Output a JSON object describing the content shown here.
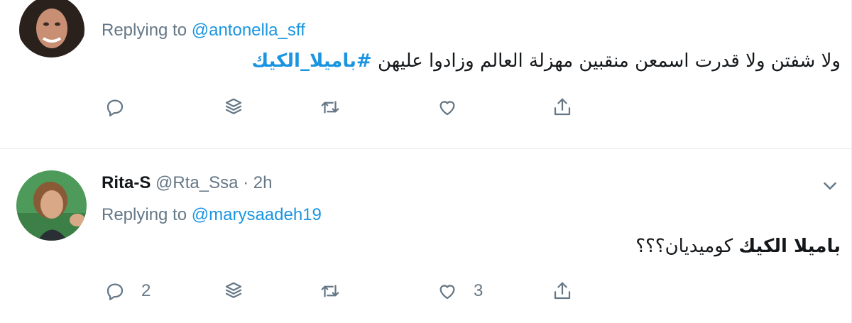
{
  "tweets": [
    {
      "display_name": "",
      "handle": "",
      "time": "",
      "replying_label": "Replying to",
      "replying_to": "@antonella_sff",
      "text_main": "ولا شفتن ولا قدرت اسمعن منقبين مهزلة العالم وزادوا عليهن",
      "hashtag": "#باميلا_الكيك",
      "actions": {
        "reply_count": "",
        "like_count": ""
      }
    },
    {
      "display_name": "Rita-S",
      "handle": "@Rta_Ssa",
      "time": "2h",
      "replying_label": "Replying to",
      "replying_to": "@marysaadeh19",
      "text_bold": "باميلا الكيك",
      "text_rest": "كوميديان؟؟؟",
      "actions": {
        "reply_count": "2",
        "like_count": "3"
      }
    }
  ],
  "colors": {
    "link": "#1b95e0",
    "muted": "#657786",
    "text": "#14171a",
    "divider": "#e6ecf0"
  },
  "icons": [
    "reply-icon",
    "stack-icon",
    "retweet-icon",
    "like-icon",
    "share-icon",
    "chevron-down-icon"
  ]
}
